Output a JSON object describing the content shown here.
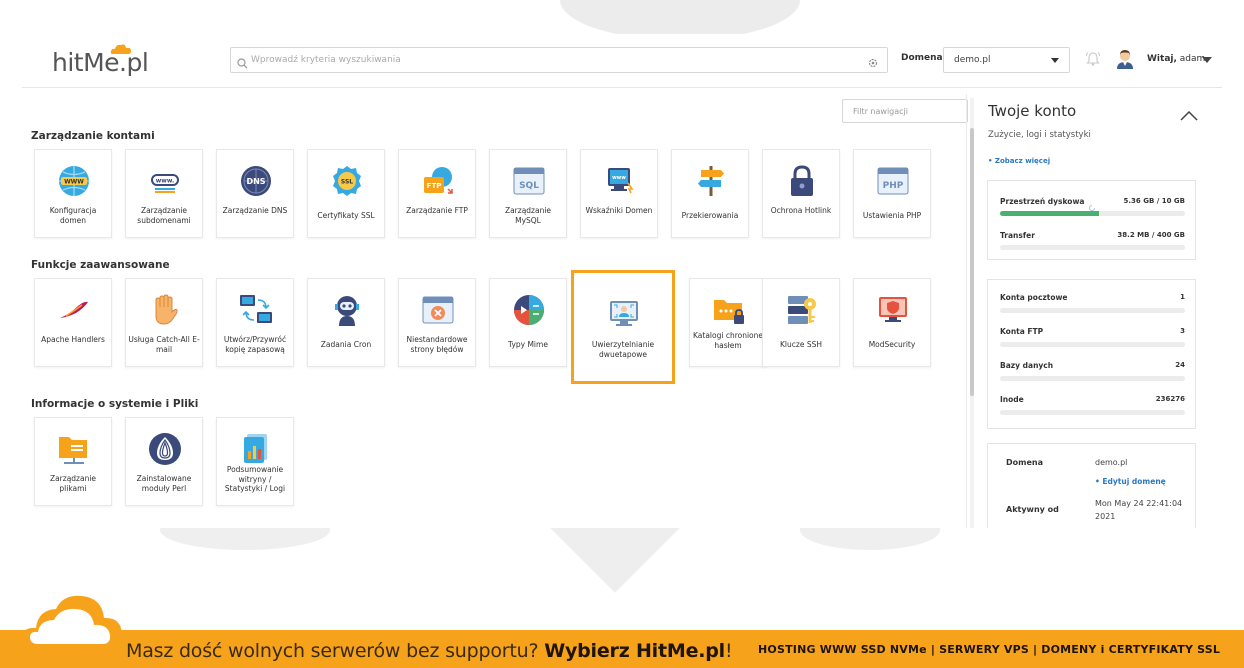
{
  "logo": {
    "text_main": "hitMe",
    "text_dot": ".pl"
  },
  "search": {
    "placeholder": "Wprowadź kryteria wyszukiwania"
  },
  "header": {
    "domain_label": "Domena",
    "domain_value": "demo.pl",
    "greeting_bold": "Witaj,",
    "greeting_name": "adam"
  },
  "filter": {
    "placeholder": "Filtr nawigacji"
  },
  "sections": {
    "accounts": {
      "title": "Zarządzanie kontami",
      "tiles": [
        {
          "label": "Konfiguracja domen",
          "icon": "www-globe-icon"
        },
        {
          "label": "Zarządzanie subdomenami",
          "icon": "subdomain-icon"
        },
        {
          "label": "Zarządzanie DNS",
          "icon": "dns-icon"
        },
        {
          "label": "Certyfikaty SSL",
          "icon": "ssl-badge-icon"
        },
        {
          "label": "Zarządzanie FTP",
          "icon": "ftp-icon"
        },
        {
          "label": "Zarządzanie MySQL",
          "icon": "sql-icon"
        },
        {
          "label": "Wskaźniki Domen",
          "icon": "domain-pointer-icon"
        },
        {
          "label": "Przekierowania",
          "icon": "signpost-icon"
        },
        {
          "label": "Ochrona Hotlink",
          "icon": "lock-icon"
        },
        {
          "label": "Ustawienia PHP",
          "icon": "php-icon"
        }
      ]
    },
    "advanced": {
      "title": "Funkcje zaawansowane",
      "tiles": [
        {
          "label": "Apache Handlers",
          "icon": "apache-feather-icon"
        },
        {
          "label": "Usługa Catch-All E-mail",
          "icon": "hand-icon"
        },
        {
          "label": "Utwórz/Przywróć kopię zapasową",
          "icon": "backup-monitors-icon"
        },
        {
          "label": "Zadania Cron",
          "icon": "robot-icon"
        },
        {
          "label": "Niestandardowe strony błędów",
          "icon": "error-page-icon"
        },
        {
          "label": "Typy Mime",
          "icon": "mime-icon"
        },
        {
          "label": "Uwierzytelnianie dwuetapowe",
          "icon": "two-factor-icon"
        },
        {
          "label": "Katalogi chronione hasłem",
          "icon": "protected-folder-icon"
        },
        {
          "label": "Klucze SSH",
          "icon": "ssh-key-icon"
        },
        {
          "label": "ModSecurity",
          "icon": "modsecurity-icon"
        }
      ]
    },
    "system": {
      "title": "Informacje o systemie i Pliki",
      "tiles": [
        {
          "label": "Zarządzanie plikami",
          "icon": "file-manager-icon"
        },
        {
          "label": "Zainstalowane moduły Perl",
          "icon": "perl-onion-icon"
        },
        {
          "label": "Podsumowanie witryny / Statystyki / Logi",
          "icon": "stats-icon"
        }
      ]
    }
  },
  "account": {
    "title": "Twoje konto",
    "subtitle": "Zużycie, logi i statystyki",
    "more_link": "• Zobacz więcej",
    "disk": {
      "label": "Przestrzeń dyskowa",
      "value": "5.36 GB / 10 GB",
      "fraction": 0.536
    },
    "transfer": {
      "label": "Transfer",
      "value": "38.2 MB / 400 GB",
      "fraction": 0.0001
    },
    "counts": [
      {
        "label": "Konta pocztowe",
        "value": "1"
      },
      {
        "label": "Konta FTP",
        "value": "3"
      },
      {
        "label": "Bazy danych",
        "value": "24"
      },
      {
        "label": "Inode",
        "value": "236276"
      }
    ],
    "domain_info": {
      "domain_label": "Domena",
      "domain_value": "demo.pl",
      "edit_link": "• Edytuj domenę",
      "active_label": "Aktywny od",
      "active_value": "Mon May 24 22:41:04 2021"
    }
  },
  "banner": {
    "text": "Masz dość wolnych serwerów bez supportu?",
    "cta": "Wybierz HitMe.pl",
    "excl": "!",
    "right": "HOSTING WWW SSD NVMe | SERWERY VPS | DOMENY i CERTYFIKATY SSL"
  },
  "colors": {
    "accent": "#f7a21b",
    "link": "#2a78c4",
    "progress": "#4caf72"
  }
}
